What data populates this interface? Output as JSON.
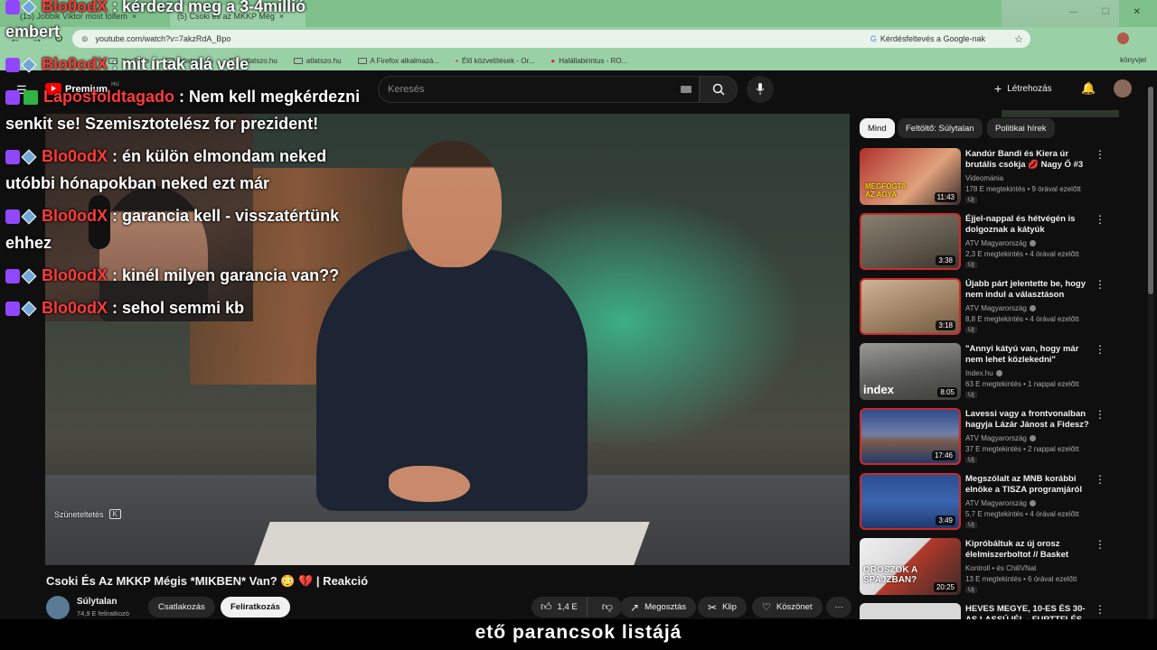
{
  "browser": {
    "tabs": [
      {
        "label": "(15) Jobbik Viktor most töltem",
        "close": "×"
      },
      {
        "label": "(5) Csoki és az MKKP Még",
        "close": "×"
      }
    ],
    "url": "youtube.com/watch?v=7akzRdA_Bpo",
    "google_search_label": "Kérdésfeltevés a Google-nak",
    "bookmarks": [
      "YouTube",
      "atlatszo.hu",
      "atlatszo.hu",
      "atlatszo.hu",
      "A Firefox alkalmazá...",
      "Élő közvetítések - Or...",
      "Halállabirintus - RO..."
    ],
    "other_bookmarks": "könyvjel"
  },
  "youtube": {
    "logo_word": "Premium",
    "logo_region": "HU",
    "search_placeholder": "Keresés",
    "create_label": "Létrehozás"
  },
  "chat": [
    {
      "nick": "Blo0odX",
      "text": ": kérdezd meg a 3-4millió",
      "cont": "embert"
    },
    {
      "nick": "Blo0odX",
      "text": ": mit írtak alá vele",
      "cont": ""
    },
    {
      "nick": "Laposfoldtagado",
      "text": ": Nem kell megkérdezni",
      "cont": "senkit se! Szemisztotelész for prezident!"
    },
    {
      "nick": "Blo0odX",
      "text": ": én külön elmondam neked",
      "cont": "utóbbi hónapokban neked ezt már"
    },
    {
      "nick": "Blo0odX",
      "text": ": garancia kell - visszatértünk",
      "cont": "ehhez"
    },
    {
      "nick": "Blo0odX",
      "text": ": kinél milyen garancia van??",
      "cont": ""
    },
    {
      "nick": "Blo0odX",
      "text": ": sehol semmi kb",
      "cont": ""
    }
  ],
  "player": {
    "pause_hint": "Szüneteltetés",
    "pause_key": "K"
  },
  "subtitle": "ető parancsok listájá",
  "video": {
    "title": "Csoki És Az MKKP Mégis *MIKBEN* Van? 😳 💔 | Reakció",
    "channel": "Súlytalan",
    "subscribers": "74,9 E feliratkozó",
    "join": "Csatlakozás",
    "subscribe": "Feliratkozás",
    "likes": "1,4 E",
    "share": "Megosztás",
    "clip": "Klip",
    "thanks": "Köszönet",
    "more": "···"
  },
  "chips": [
    "Mind",
    "Feltöltő: Súlytalan",
    "Politikai hírek"
  ],
  "recommendations": [
    {
      "title": "Kandúr Bandi és Kiera úr brutális csókja 💋 Nagy Ő #3",
      "channel": "Videománia",
      "meta": "178 E megtekintés • 9 órával ezelőtt",
      "new": "Új",
      "duration": "11:43",
      "thumb_text": "MEGFOGTA AZ AGYA",
      "color": "#b0312e"
    },
    {
      "title": "Éjjel-nappal és hétvégén is dolgoznak a kátyúk kijavításá...",
      "channel": "ATV Magyarország",
      "meta": "2,3 E megtekintés • 4 órával ezelőtt",
      "new": "Új",
      "duration": "3:38",
      "thumb_text": "",
      "color": "#6b6254"
    },
    {
      "title": "Újabb párt jelentette be, hogy nem indul a választáson",
      "channel": "ATV Magyarország",
      "meta": "8,8 E megtekintés • 4 órával ezelőtt",
      "new": "Új",
      "duration": "3:18",
      "thumb_text": "",
      "color": "#a38b6e"
    },
    {
      "title": "\"Annyi kátyú van, hogy már nem lehet közlekedni\"",
      "channel": "Index.hu",
      "meta": "63 E megtekintés • 1 nappal ezelőtt",
      "new": "Új",
      "duration": "8:05",
      "thumb_text": "index",
      "color": "#5d5d5a"
    },
    {
      "title": "Lavessi vagy a frontvonalban hagyja Lázár Jánost a Fidesz?",
      "channel": "ATV Magyarország",
      "meta": "37 E megtekintés • 2 nappal ezelőtt",
      "new": "Új",
      "duration": "17:46",
      "thumb_text": "",
      "color": "#2f4a8c"
    },
    {
      "title": "Megszólalt az MNB korábbi elnöke a TISZA programjáról",
      "channel": "ATV Magyarország",
      "meta": "5,7 E megtekintés • 4 órával ezelőtt",
      "new": "Új",
      "duration": "3:49",
      "thumb_text": "",
      "color": "#2b4f8f"
    },
    {
      "title": "Kipróbáltuk az új orosz élelmiszerboltot // Basket Plu...",
      "channel": "Kontroll • és ChiliVNat",
      "meta": "13 E megtekintés • 6 órával ezelőtt",
      "new": "Új",
      "duration": "20:25",
      "thumb_text": "OROSZOK A SPAJZBAN?",
      "color": "#b33a2a"
    },
    {
      "title": "HEVES MEGYE, 10-ES ÉS 30-AS LASSÚ IÉL - FURTTFLÉS",
      "channel": "",
      "meta": "",
      "new": "",
      "duration": "",
      "thumb_text": "",
      "color": "#d8d8d8"
    }
  ]
}
